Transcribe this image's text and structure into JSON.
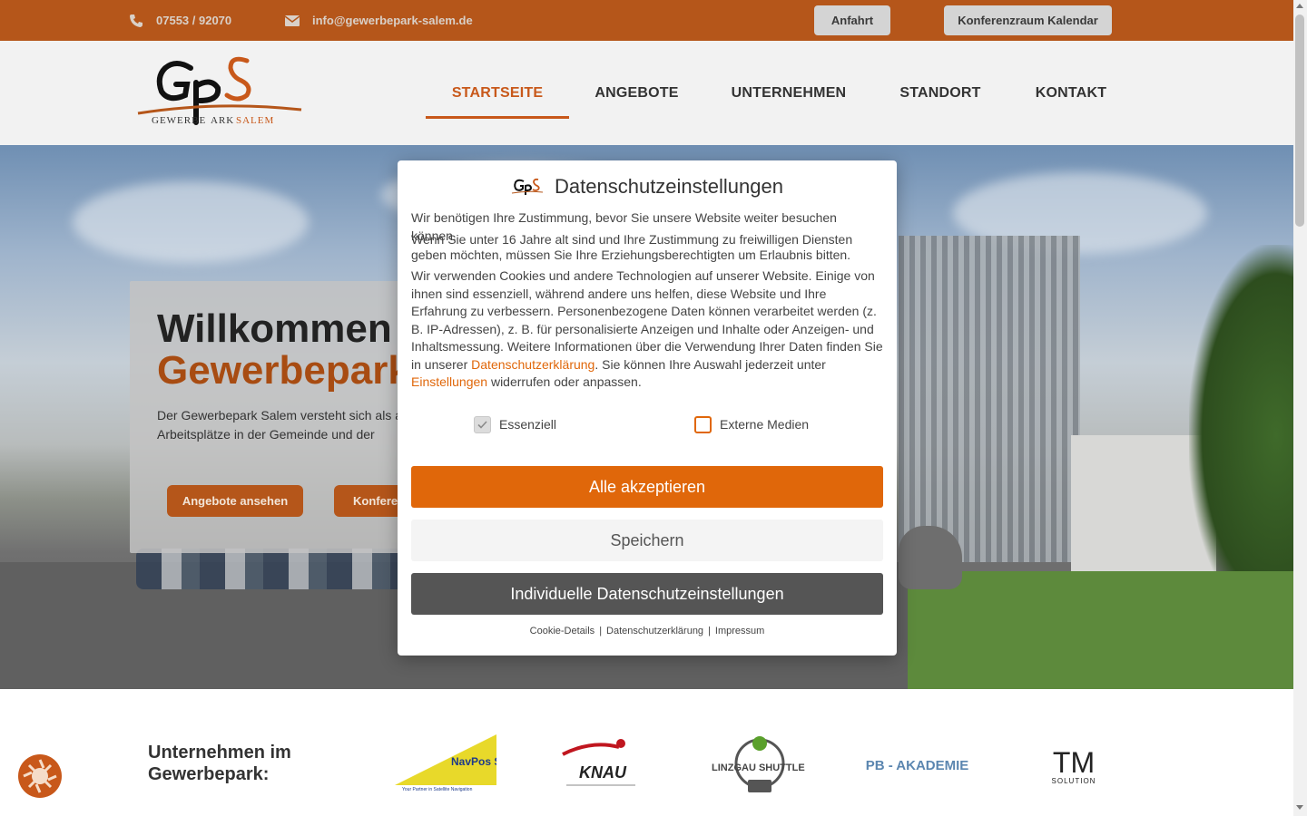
{
  "topbar": {
    "phone": "07553 / 92070",
    "email": "info@gewerbepark-salem.de",
    "btn_anfahrt": "Anfahrt",
    "btn_kalender": "Konferenzraum Kalendar",
    "icons": [
      "phone-icon",
      "envelope-icon"
    ]
  },
  "brand": {
    "logo_letters": "GpS",
    "logo_subtitle": "GEWERBEPARK SALEM",
    "accent": "#c8581a",
    "topbar_color": "#b5561a"
  },
  "nav": {
    "items": [
      "STARTSEITE",
      "ANGEBOTE",
      "UNTERNEHMEN",
      "STANDORT",
      "KONTAKT"
    ],
    "active": "STARTSEITE"
  },
  "hero": {
    "title_line1": "Willkommen i",
    "title_line2": "Gewerbepark",
    "text": "Der Gewerbepark Salem versteht sich als a um Arbeitsplätze in der Gemeinde und der",
    "btn1": "Angebote ansehen",
    "btn2": "Konferen"
  },
  "companies": {
    "title": "Unternehmen im Gewerbepark:",
    "logos": [
      {
        "name": "NavPos Systems",
        "tagline": "Your Partner in Satellite Navigation"
      },
      {
        "name": "KNAU",
        "tagline": ""
      },
      {
        "name": "LINZGAU SHUTTLE",
        "tagline": ""
      },
      {
        "name": "PB - AKADEMIE",
        "tagline": ""
      },
      {
        "name": "TM",
        "tagline": "SOLUTION"
      }
    ]
  },
  "modal": {
    "title": "Datenschutzeinstellungen",
    "p1": "Wir benötigen Ihre Zustimmung, bevor Sie unsere Website weiter besuchen können.",
    "p2": "Wenn Sie unter 16 Jahre alt sind und Ihre Zustimmung zu freiwilligen Diensten geben möchten, müssen Sie Ihre Erziehungsberechtigten um Erlaubnis bitten.",
    "p3_a": "Wir verwenden Cookies und andere Technologien auf unserer Website. Einige von ihnen sind essenziell, während andere uns helfen, diese Website und Ihre Erfahrung zu verbessern. Personenbezogene Daten können verarbeitet werden (z. B. IP-Adressen), z. B. für personalisierte Anzeigen und Inhalte oder Anzeigen- und Inhaltsmessung. Weitere Informationen über die Verwendung Ihrer Daten finden Sie in unserer ",
    "p3_link1": "Datenschutzerklärung",
    "p3_b": ". Sie können Ihre Auswahl jederzeit unter ",
    "p3_link2": "Einstellungen",
    "p3_c": " widerrufen oder anpassen.",
    "check_essenziell": "Essenziell",
    "check_extern": "Externe Medien",
    "essenziell_checked": true,
    "extern_checked": false,
    "btn_accept": "Alle akzeptieren",
    "btn_save": "Speichern",
    "btn_individual": "Individuelle Datenschutzeinstellungen",
    "link_cookie": "Cookie-Details",
    "link_privacy": "Datenschutzerklärung",
    "link_imprint": "Impressum",
    "sep": "|"
  }
}
